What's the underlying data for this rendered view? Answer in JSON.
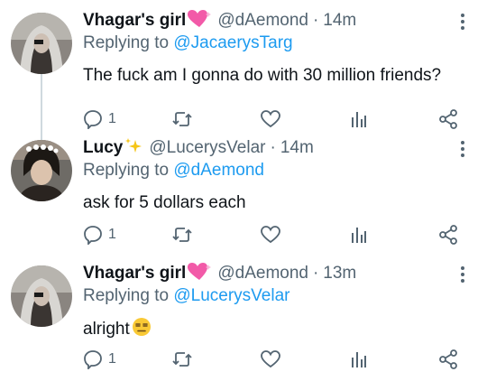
{
  "tweets": [
    {
      "display_name": "Vhagar's girl",
      "handle": "@dAemond",
      "time": "14m",
      "replying_prefix": "Replying to ",
      "replying_to": "@JacaerysTarg",
      "text": "The fuck am I gonna do with 30 million friends?",
      "reply_count": "1",
      "name_emoji": "sparkling-heart-icon"
    },
    {
      "display_name": "Lucy",
      "handle": "@LucerysVelar",
      "time": "14m",
      "replying_prefix": "Replying to ",
      "replying_to": "@dAemond",
      "text": "ask for 5 dollars each",
      "reply_count": "1",
      "name_emoji": "sparkles-icon"
    },
    {
      "display_name": "Vhagar's girl",
      "handle": "@dAemond",
      "time": "13m",
      "replying_prefix": "Replying to ",
      "replying_to": "@LucerysVelar",
      "text": "alright",
      "reply_count": "1",
      "name_emoji": "sparkling-heart-icon",
      "text_emoji": "unamused-face-icon"
    }
  ],
  "colors": {
    "accent": "#1d9bf0",
    "secondary_text": "#536471",
    "thread_line": "#cfd9de"
  }
}
